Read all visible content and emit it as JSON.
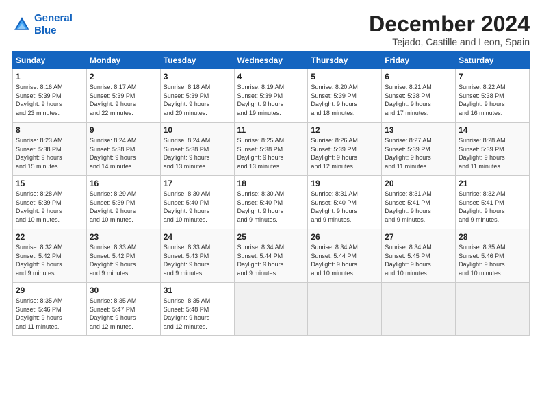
{
  "logo": {
    "line1": "General",
    "line2": "Blue"
  },
  "title": "December 2024",
  "subtitle": "Tejado, Castille and Leon, Spain",
  "days_of_week": [
    "Sunday",
    "Monday",
    "Tuesday",
    "Wednesday",
    "Thursday",
    "Friday",
    "Saturday"
  ],
  "weeks": [
    [
      {
        "day": 1,
        "lines": [
          "Sunrise: 8:16 AM",
          "Sunset: 5:39 PM",
          "Daylight: 9 hours",
          "and 23 minutes."
        ]
      },
      {
        "day": 2,
        "lines": [
          "Sunrise: 8:17 AM",
          "Sunset: 5:39 PM",
          "Daylight: 9 hours",
          "and 22 minutes."
        ]
      },
      {
        "day": 3,
        "lines": [
          "Sunrise: 8:18 AM",
          "Sunset: 5:39 PM",
          "Daylight: 9 hours",
          "and 20 minutes."
        ]
      },
      {
        "day": 4,
        "lines": [
          "Sunrise: 8:19 AM",
          "Sunset: 5:39 PM",
          "Daylight: 9 hours",
          "and 19 minutes."
        ]
      },
      {
        "day": 5,
        "lines": [
          "Sunrise: 8:20 AM",
          "Sunset: 5:39 PM",
          "Daylight: 9 hours",
          "and 18 minutes."
        ]
      },
      {
        "day": 6,
        "lines": [
          "Sunrise: 8:21 AM",
          "Sunset: 5:38 PM",
          "Daylight: 9 hours",
          "and 17 minutes."
        ]
      },
      {
        "day": 7,
        "lines": [
          "Sunrise: 8:22 AM",
          "Sunset: 5:38 PM",
          "Daylight: 9 hours",
          "and 16 minutes."
        ]
      }
    ],
    [
      {
        "day": 8,
        "lines": [
          "Sunrise: 8:23 AM",
          "Sunset: 5:38 PM",
          "Daylight: 9 hours",
          "and 15 minutes."
        ]
      },
      {
        "day": 9,
        "lines": [
          "Sunrise: 8:24 AM",
          "Sunset: 5:38 PM",
          "Daylight: 9 hours",
          "and 14 minutes."
        ]
      },
      {
        "day": 10,
        "lines": [
          "Sunrise: 8:24 AM",
          "Sunset: 5:38 PM",
          "Daylight: 9 hours",
          "and 13 minutes."
        ]
      },
      {
        "day": 11,
        "lines": [
          "Sunrise: 8:25 AM",
          "Sunset: 5:38 PM",
          "Daylight: 9 hours",
          "and 13 minutes."
        ]
      },
      {
        "day": 12,
        "lines": [
          "Sunrise: 8:26 AM",
          "Sunset: 5:39 PM",
          "Daylight: 9 hours",
          "and 12 minutes."
        ]
      },
      {
        "day": 13,
        "lines": [
          "Sunrise: 8:27 AM",
          "Sunset: 5:39 PM",
          "Daylight: 9 hours",
          "and 11 minutes."
        ]
      },
      {
        "day": 14,
        "lines": [
          "Sunrise: 8:28 AM",
          "Sunset: 5:39 PM",
          "Daylight: 9 hours",
          "and 11 minutes."
        ]
      }
    ],
    [
      {
        "day": 15,
        "lines": [
          "Sunrise: 8:28 AM",
          "Sunset: 5:39 PM",
          "Daylight: 9 hours",
          "and 10 minutes."
        ]
      },
      {
        "day": 16,
        "lines": [
          "Sunrise: 8:29 AM",
          "Sunset: 5:39 PM",
          "Daylight: 9 hours",
          "and 10 minutes."
        ]
      },
      {
        "day": 17,
        "lines": [
          "Sunrise: 8:30 AM",
          "Sunset: 5:40 PM",
          "Daylight: 9 hours",
          "and 10 minutes."
        ]
      },
      {
        "day": 18,
        "lines": [
          "Sunrise: 8:30 AM",
          "Sunset: 5:40 PM",
          "Daylight: 9 hours",
          "and 9 minutes."
        ]
      },
      {
        "day": 19,
        "lines": [
          "Sunrise: 8:31 AM",
          "Sunset: 5:40 PM",
          "Daylight: 9 hours",
          "and 9 minutes."
        ]
      },
      {
        "day": 20,
        "lines": [
          "Sunrise: 8:31 AM",
          "Sunset: 5:41 PM",
          "Daylight: 9 hours",
          "and 9 minutes."
        ]
      },
      {
        "day": 21,
        "lines": [
          "Sunrise: 8:32 AM",
          "Sunset: 5:41 PM",
          "Daylight: 9 hours",
          "and 9 minutes."
        ]
      }
    ],
    [
      {
        "day": 22,
        "lines": [
          "Sunrise: 8:32 AM",
          "Sunset: 5:42 PM",
          "Daylight: 9 hours",
          "and 9 minutes."
        ]
      },
      {
        "day": 23,
        "lines": [
          "Sunrise: 8:33 AM",
          "Sunset: 5:42 PM",
          "Daylight: 9 hours",
          "and 9 minutes."
        ]
      },
      {
        "day": 24,
        "lines": [
          "Sunrise: 8:33 AM",
          "Sunset: 5:43 PM",
          "Daylight: 9 hours",
          "and 9 minutes."
        ]
      },
      {
        "day": 25,
        "lines": [
          "Sunrise: 8:34 AM",
          "Sunset: 5:44 PM",
          "Daylight: 9 hours",
          "and 9 minutes."
        ]
      },
      {
        "day": 26,
        "lines": [
          "Sunrise: 8:34 AM",
          "Sunset: 5:44 PM",
          "Daylight: 9 hours",
          "and 10 minutes."
        ]
      },
      {
        "day": 27,
        "lines": [
          "Sunrise: 8:34 AM",
          "Sunset: 5:45 PM",
          "Daylight: 9 hours",
          "and 10 minutes."
        ]
      },
      {
        "day": 28,
        "lines": [
          "Sunrise: 8:35 AM",
          "Sunset: 5:46 PM",
          "Daylight: 9 hours",
          "and 10 minutes."
        ]
      }
    ],
    [
      {
        "day": 29,
        "lines": [
          "Sunrise: 8:35 AM",
          "Sunset: 5:46 PM",
          "Daylight: 9 hours",
          "and 11 minutes."
        ]
      },
      {
        "day": 30,
        "lines": [
          "Sunrise: 8:35 AM",
          "Sunset: 5:47 PM",
          "Daylight: 9 hours",
          "and 12 minutes."
        ]
      },
      {
        "day": 31,
        "lines": [
          "Sunrise: 8:35 AM",
          "Sunset: 5:48 PM",
          "Daylight: 9 hours",
          "and 12 minutes."
        ]
      },
      null,
      null,
      null,
      null
    ]
  ]
}
